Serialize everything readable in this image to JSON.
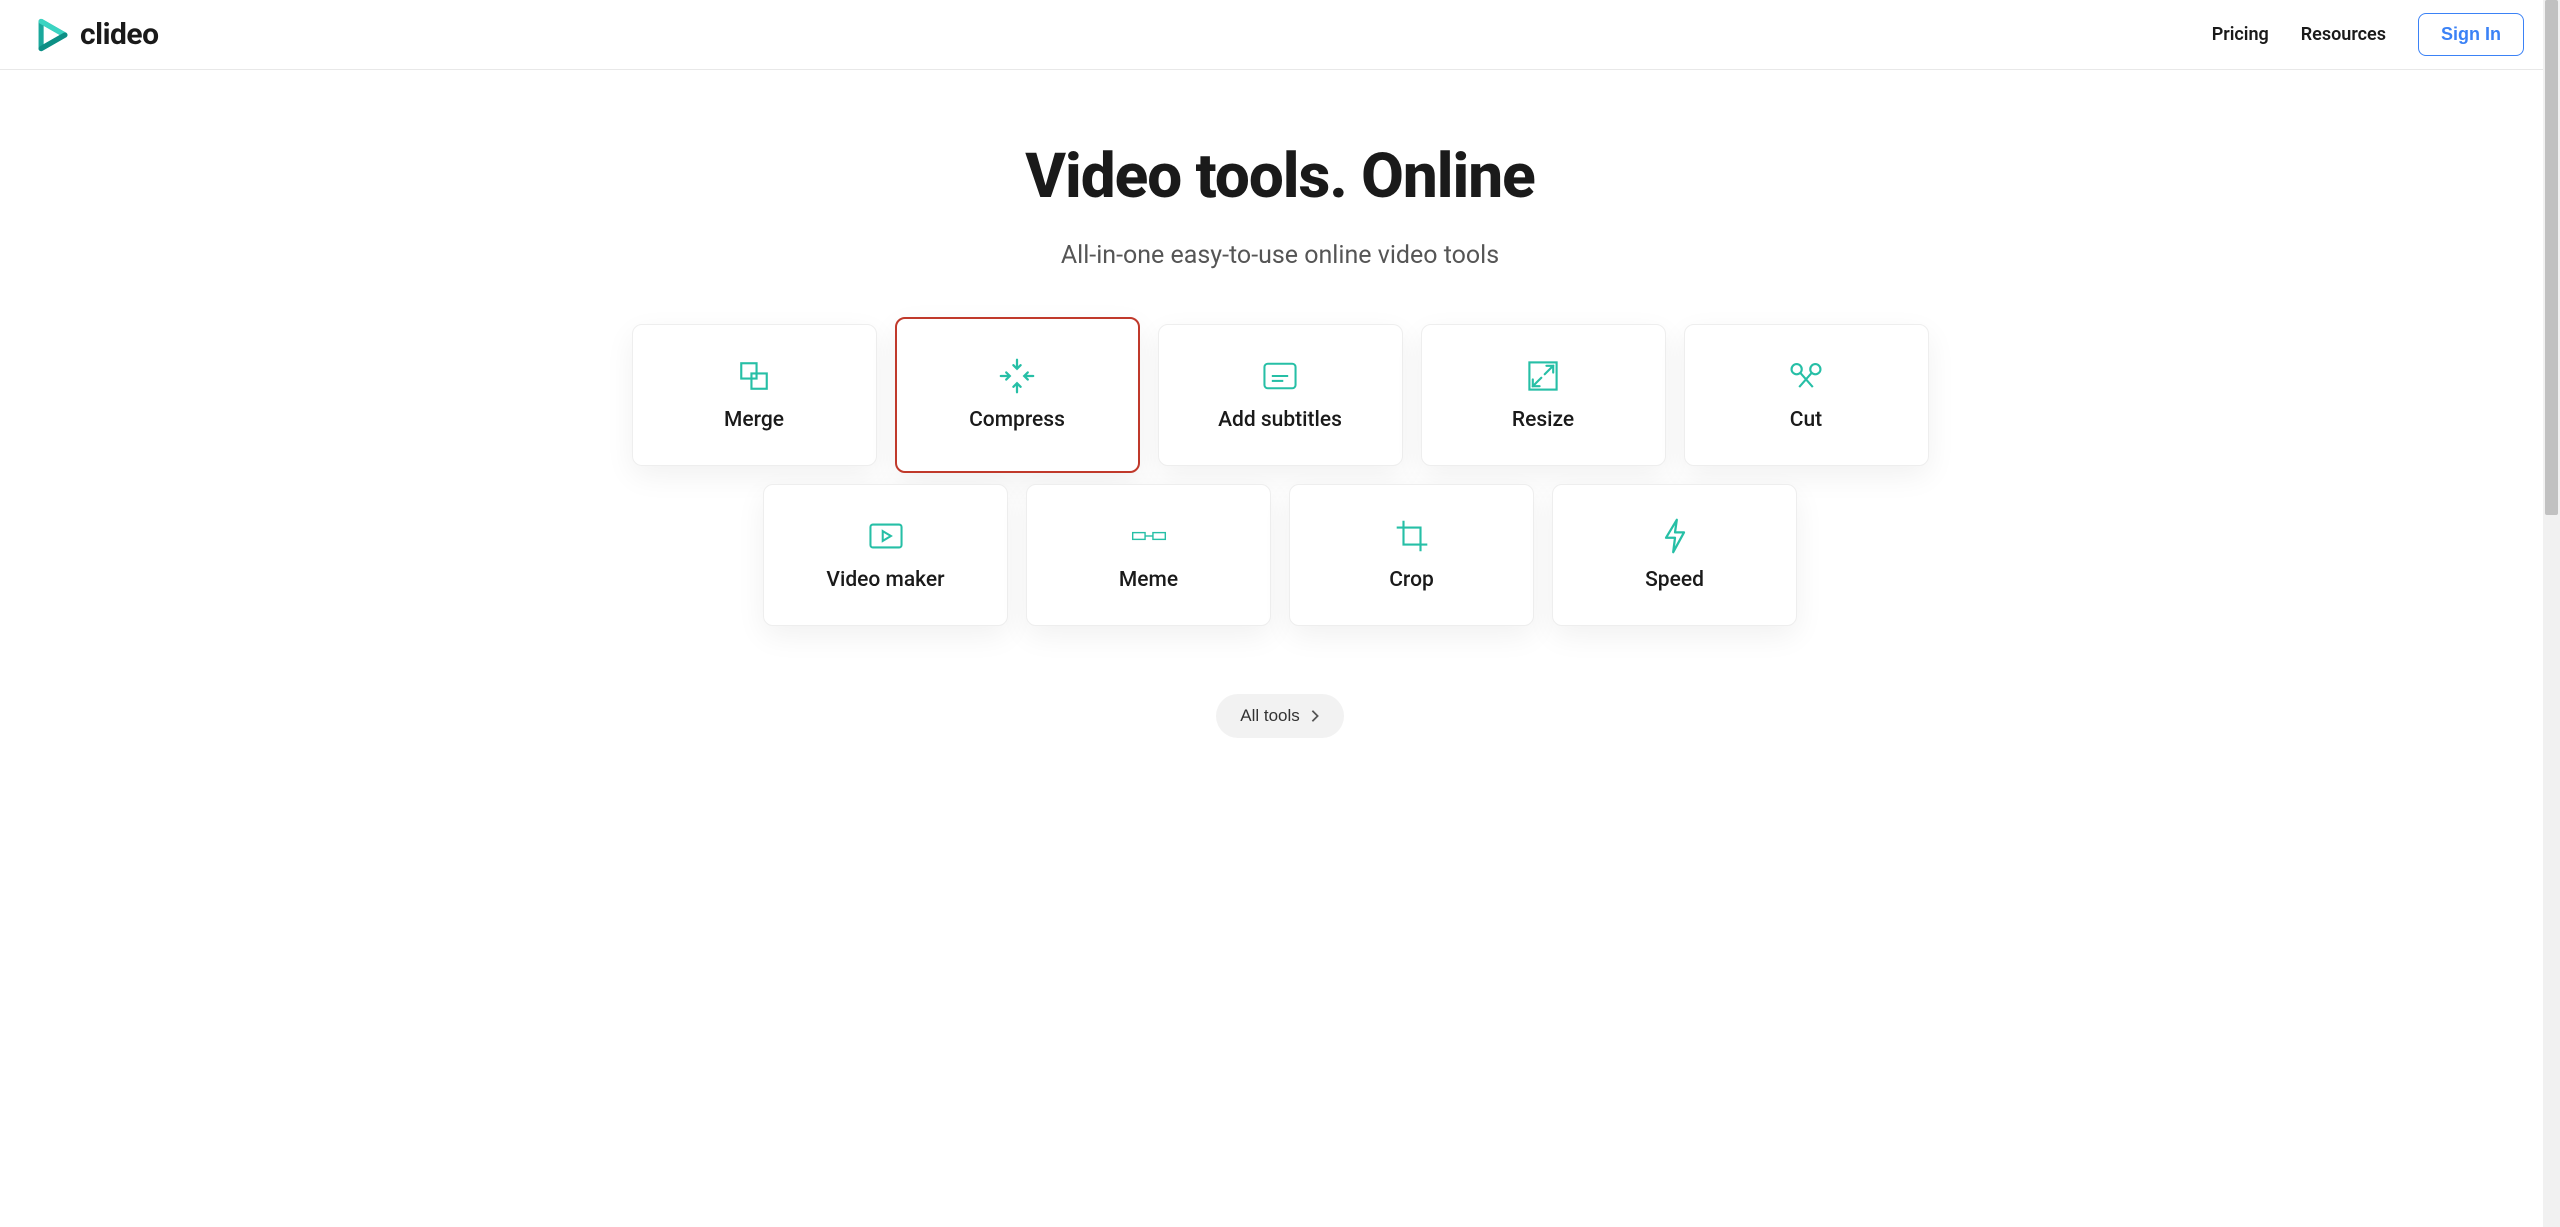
{
  "header": {
    "logo_text": "clideo",
    "nav": {
      "pricing": "Pricing",
      "resources": "Resources",
      "signin": "Sign In"
    }
  },
  "hero": {
    "title": "Video tools. Online",
    "subtitle": "All-in-one easy-to-use online video tools"
  },
  "tools_row1": [
    {
      "id": "merge",
      "label": "Merge",
      "icon": "merge-icon",
      "highlighted": false
    },
    {
      "id": "compress",
      "label": "Compress",
      "icon": "compress-icon",
      "highlighted": true
    },
    {
      "id": "add-subtitles",
      "label": "Add subtitles",
      "icon": "subtitles-icon",
      "highlighted": false
    },
    {
      "id": "resize",
      "label": "Resize",
      "icon": "resize-icon",
      "highlighted": false
    },
    {
      "id": "cut",
      "label": "Cut",
      "icon": "cut-icon",
      "highlighted": false
    }
  ],
  "tools_row2": [
    {
      "id": "video-maker",
      "label": "Video maker",
      "icon": "videomaker-icon"
    },
    {
      "id": "meme",
      "label": "Meme",
      "icon": "meme-icon"
    },
    {
      "id": "crop",
      "label": "Crop",
      "icon": "crop-icon"
    },
    {
      "id": "speed",
      "label": "Speed",
      "icon": "speed-icon"
    }
  ],
  "all_tools_label": "All tools",
  "colors": {
    "accent": "#26bfa6",
    "highlight_border": "#c0392b",
    "signin_blue": "#3b82f6"
  }
}
